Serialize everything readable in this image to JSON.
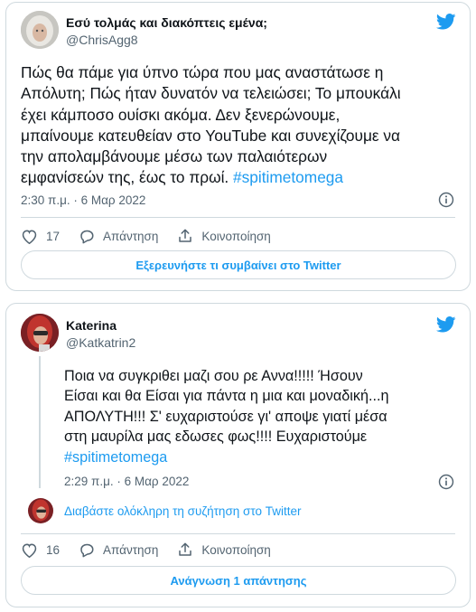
{
  "tweet1": {
    "display_name": "Εσύ τολμάς και διακόπτεις εμένα;",
    "handle": "@ChrisAgg8",
    "text_lines": [
      "Πώς θα πάμε για ύπνο τώρα που μας αναστάτωσε η",
      "Απόλυτη; Πώς ήταν δυνατόν να τελειώσει; Το μπουκάλι",
      "έχει κάμποσο ουίσκι ακόμα. Δεν ξενερώνουμε,",
      "μπαίνουμε κατευθείαν στο YouTube και συνεχίζουμε να",
      "την απολαμβάνουμε μέσω των παλαιότερων",
      "εμφανίσεών της, έως το πρωί. "
    ],
    "hashtag": "#spitimetomega",
    "timestamp": "2:30 π.μ. · 6 Μαρ 2022",
    "likes": "17",
    "reply_label": "Απάντηση",
    "share_label": "Κοινοποίηση",
    "cta_label": "Εξερευνήστε τι συμβαίνει στο Twitter"
  },
  "tweet2": {
    "display_name": "Katerina",
    "handle": "@Katkatrin2",
    "text_lines": [
      "Ποια να συγκριθει μαζι σου ρε Αννα!!!!! Ήσουν",
      "Είσαι και θα Είσαι για πάντα η μια και μοναδική...η",
      "ΑΠΟΛΥΤΗ!!! Σ' ευχαριστούσε γι' αποψε γιατί μέσα",
      "στη μαυρίλα μας εδωσες φως!!!! Ευχαριστούμε"
    ],
    "hashtag": "#spitimetomega",
    "timestamp": "2:29 π.μ. · 6 Μαρ 2022",
    "convo_label": "Διαβάστε ολόκληρη τη συζήτηση στο Twitter",
    "likes": "16",
    "reply_label": "Απάντηση",
    "share_label": "Κοινοποίηση",
    "cta_label": "Ανάγνωση 1 απάντησης"
  },
  "colors": {
    "accent": "#1d9bf0",
    "text": "#0f1419",
    "muted": "#536471",
    "border": "#cfd9de"
  },
  "icons": [
    "twitter-bird-icon",
    "info-icon",
    "heart-icon",
    "reply-bubble-icon",
    "share-icon"
  ]
}
